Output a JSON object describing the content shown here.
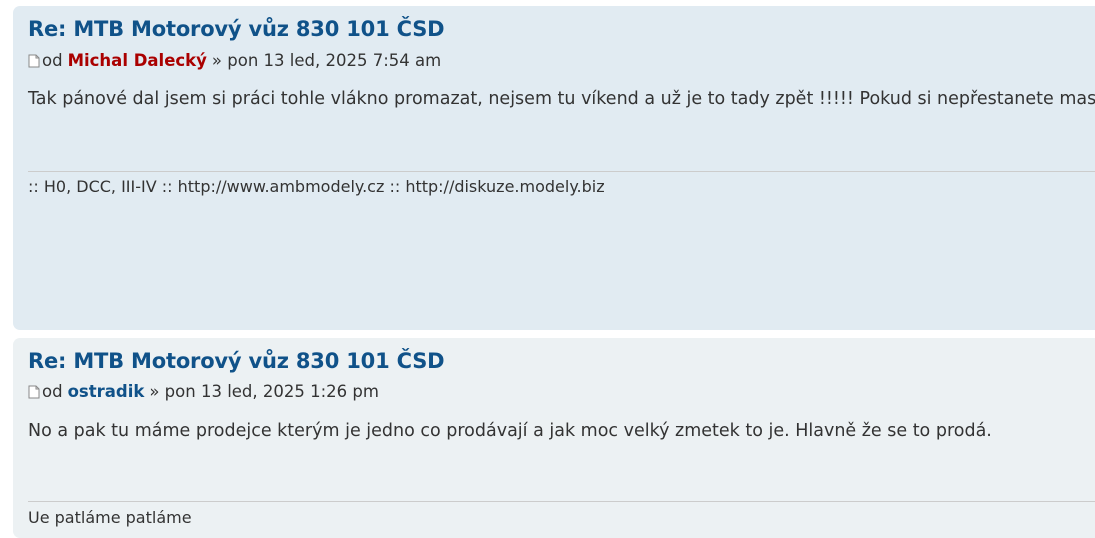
{
  "posts": [
    {
      "title": "Re: MTB Motorový vůz 830 101 ČSD",
      "by_label": "od",
      "author": "Michal Dalecký",
      "author_color": "#aa0000",
      "date": "» pon 13 led, 2025 7:54 am",
      "body": "Tak pánové dal jsem si práci tohle vlákno promazat, nejsem tu víkend a už je to tady zpět !!!!! Pokud si nepřestanete mas",
      "signature": ":: H0, DCC, III-IV :: http://www.ambmodely.cz :: http://diskuze.modely.biz"
    },
    {
      "title": "Re: MTB Motorový vůz 830 101 ČSD",
      "by_label": "od",
      "author": "ostradik",
      "author_color": "#105289",
      "date": "» pon 13 led, 2025 1:26 pm",
      "body": "No a pak tu máme prodejce kterým je jedno co prodávají a jak moc velký zmetek to je. Hlavně že se to prodá.",
      "signature": "Ue patláme patláme"
    }
  ],
  "icons": {
    "post_icon": "post-document-icon"
  }
}
